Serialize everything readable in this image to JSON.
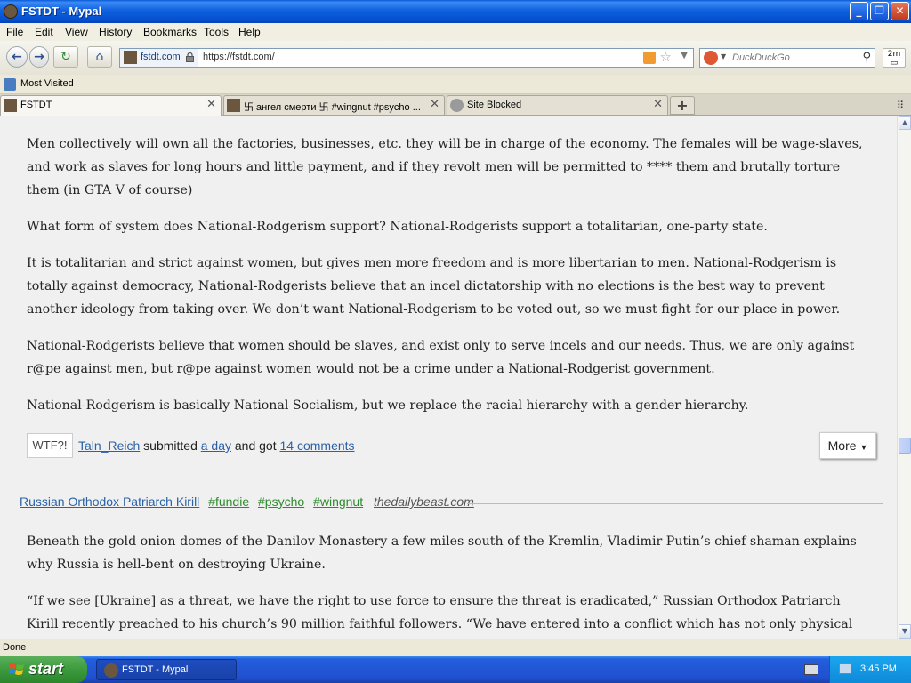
{
  "window": {
    "title": "FSTDT - Mypal"
  },
  "menu": [
    "File",
    "Edit",
    "View",
    "History",
    "Bookmarks",
    "Tools",
    "Help"
  ],
  "nav": {
    "identity_domain": "fstdt.com",
    "url": "https://fstdt.com/",
    "search_placeholder": "DuckDuckGo",
    "zoom_label": "2m"
  },
  "bookmarks": {
    "most_visited": "Most Visited"
  },
  "tabs": [
    {
      "label": "FSTDT"
    },
    {
      "label": "卐 ангел смерти 卐 #wingnut #psycho ..."
    },
    {
      "label": "Site Blocked"
    }
  ],
  "post1": {
    "paragraphs": [
      "Men collectively will own all the factories, businesses, etc. they will be in charge of the economy. The females will be wage-slaves, and work as slaves for long hours and little payment, and if they revolt men will be permitted to **** them and brutally torture them (in GTA V of course)",
      "What form of system does National-Rodgerism support? National-Rodgerists support a totalitarian, one-party state.",
      "It is totalitarian and strict against women, but gives men more freedom and is more libertarian to men. National-Rodgerism is totally against democracy, National-Rodgerists believe that an incel dictatorship with no elections is the best way to prevent another ideology from taking over. We don’t want National-Rodgerism to be voted out, so we must fight for our place in power.",
      "National-Rodgerists believe that women should be slaves, and exist only to serve incels and our needs. Thus, we are only against r@pe against men, but r@pe against women would not be a crime under a National-Rodgerist government.",
      "National-Rodgerism is basically National Socialism, but we replace the racial hierarchy with a gender hierarchy."
    ],
    "wtf": "WTF?!",
    "submitter": "Taln_Reich",
    "submitted_text": "submitted",
    "when": "a day",
    "got_text": "and got",
    "comments": "14 comments",
    "more": "More"
  },
  "post2": {
    "author": "Russian Orthodox Patriarch Kirill",
    "tags": [
      "#fundie",
      "#psycho",
      "#wingnut"
    ],
    "source": "thedailybeast.com",
    "paragraphs": [
      "Beneath the gold onion domes of the Danilov Monastery a few miles south of the Kremlin, Vladimir Putin’s chief shaman explains why Russia is hell-bent on destroying Ukraine.",
      "“If we see [Ukraine] as a threat, we have the right to use force to ensure the threat is eradicated,” Russian Orthodox Patriarch Kirill recently preached to his church’s 90 million faithful followers. “We have entered into a conflict which has not only physical but also"
    ]
  },
  "status": {
    "text": "Done"
  },
  "taskbar": {
    "start": "start",
    "item": "FSTDT - Mypal",
    "clock": "3:45 PM"
  }
}
